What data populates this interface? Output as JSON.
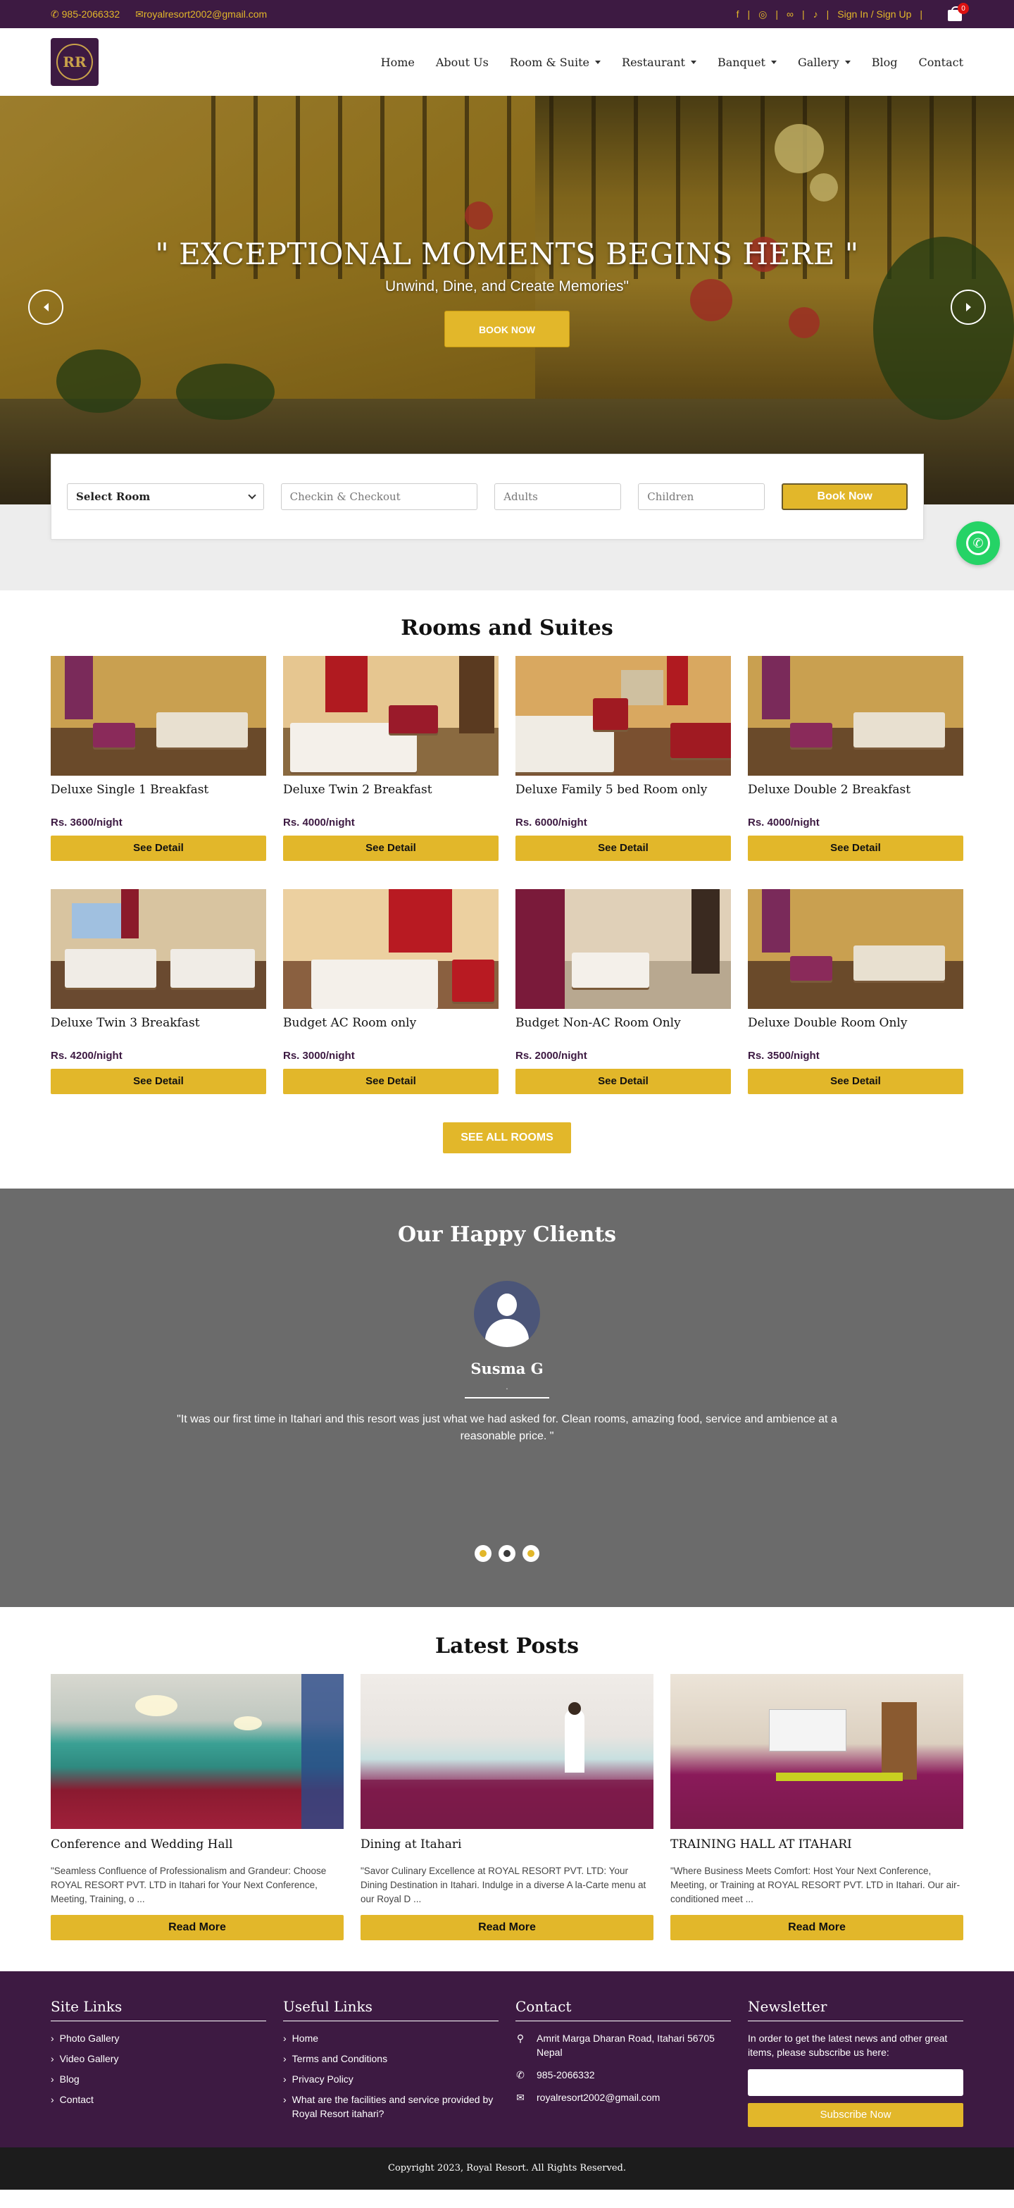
{
  "topbar": {
    "phone": "985-2066332",
    "email": "royalresort2002@gmail.com",
    "social_icons": [
      "facebook-icon",
      "instagram-icon",
      "tripadvisor-icon",
      "tiktok-icon"
    ],
    "auth_label": "Sign In / Sign Up",
    "cart_count": "0"
  },
  "logo": {
    "text": "RR"
  },
  "nav": {
    "items": [
      {
        "label": "Home",
        "dropdown": false
      },
      {
        "label": "About Us",
        "dropdown": false
      },
      {
        "label": "Room & Suite",
        "dropdown": true
      },
      {
        "label": "Restaurant",
        "dropdown": true
      },
      {
        "label": "Banquet",
        "dropdown": true
      },
      {
        "label": "Gallery",
        "dropdown": true
      },
      {
        "label": "Blog",
        "dropdown": false
      },
      {
        "label": "Contact",
        "dropdown": false
      }
    ]
  },
  "hero": {
    "title": "\" EXCEPTIONAL MOMENTS BEGINS HERE \"",
    "subtitle": "Unwind, Dine, and Create Memories\"",
    "button": "BOOK NOW"
  },
  "booking": {
    "room_select": "Select Room",
    "date_placeholder": "Checkin & Checkout",
    "adults_placeholder": "Adults",
    "children_placeholder": "Children",
    "button": "Book Now"
  },
  "rooms": {
    "title": "Rooms and Suites",
    "detail_label": "See Detail",
    "see_all": "SEE ALL ROOMS",
    "items": [
      {
        "name": "Deluxe Single 1 Breakfast",
        "price": "Rs. 3600/night"
      },
      {
        "name": "Deluxe Twin 2 Breakfast",
        "price": "Rs. 4000/night"
      },
      {
        "name": "Deluxe Family 5 bed Room only",
        "price": "Rs. 6000/night"
      },
      {
        "name": "Deluxe Double 2 Breakfast",
        "price": "Rs. 4000/night"
      },
      {
        "name": "Deluxe Twin 3 Breakfast",
        "price": "Rs. 4200/night"
      },
      {
        "name": "Budget AC Room only",
        "price": "Rs. 3000/night"
      },
      {
        "name": "Budget Non-AC Room Only",
        "price": "Rs. 2000/night"
      },
      {
        "name": "Deluxe Double Room Only",
        "price": "Rs. 3500/night"
      }
    ]
  },
  "clients": {
    "title": "Our Happy Clients",
    "name": "Susma G",
    "dot": ".",
    "quote": "\"It was our first time in Itahari and this resort was just what we had asked for. Clean rooms, amazing food, service and ambience at a reasonable price. \"",
    "slides": 3,
    "active_slide": 2
  },
  "posts": {
    "title": "Latest Posts",
    "read_label": "Read More",
    "items": [
      {
        "title": "Conference and Wedding Hall",
        "text": "\"Seamless Confluence of Professionalism and Grandeur: Choose ROYAL RESORT PVT. LTD in Itahari for Your Next Conference, Meeting, Training, o ..."
      },
      {
        "title": "Dining at Itahari",
        "text": "\"Savor Culinary Excellence at ROYAL RESORT PVT. LTD: Your Dining Destination in Itahari. Indulge in a diverse A la-Carte menu at our Royal D ..."
      },
      {
        "title": "TRAINING HALL AT ITAHARI",
        "text": "\"Where Business Meets Comfort: Host Your Next Conference, Meeting, or Training at ROYAL RESORT PVT. LTD in Itahari. Our air-conditioned meet ..."
      }
    ]
  },
  "footer": {
    "site_links": {
      "title": "Site Links",
      "items": [
        "Photo Gallery",
        "Video Gallery",
        "Blog",
        "Contact"
      ]
    },
    "useful_links": {
      "title": "Useful Links",
      "items": [
        "Home",
        "Terms and Conditions",
        "Privacy Policy",
        "What are the facilities and service provided by Royal Resort itahari?"
      ]
    },
    "contact": {
      "title": "Contact",
      "address": "Amrit Marga Dharan Road, Itahari 56705 Nepal",
      "phone": "985-2066332",
      "email": "royalresort2002@gmail.com"
    },
    "newsletter": {
      "title": "Newsletter",
      "text": "In order to get the latest news and other great items, please subscribe us here:",
      "button": "Subscribe Now"
    },
    "copyright": "Copyright 2023, Royal Resort. All Rights Reserved."
  },
  "colors": {
    "brand_purple": "#3d1a42",
    "accent_gold": "#e2b72a",
    "whatsapp_green": "#25d366",
    "testimonial_bg": "#6b6b6b"
  }
}
